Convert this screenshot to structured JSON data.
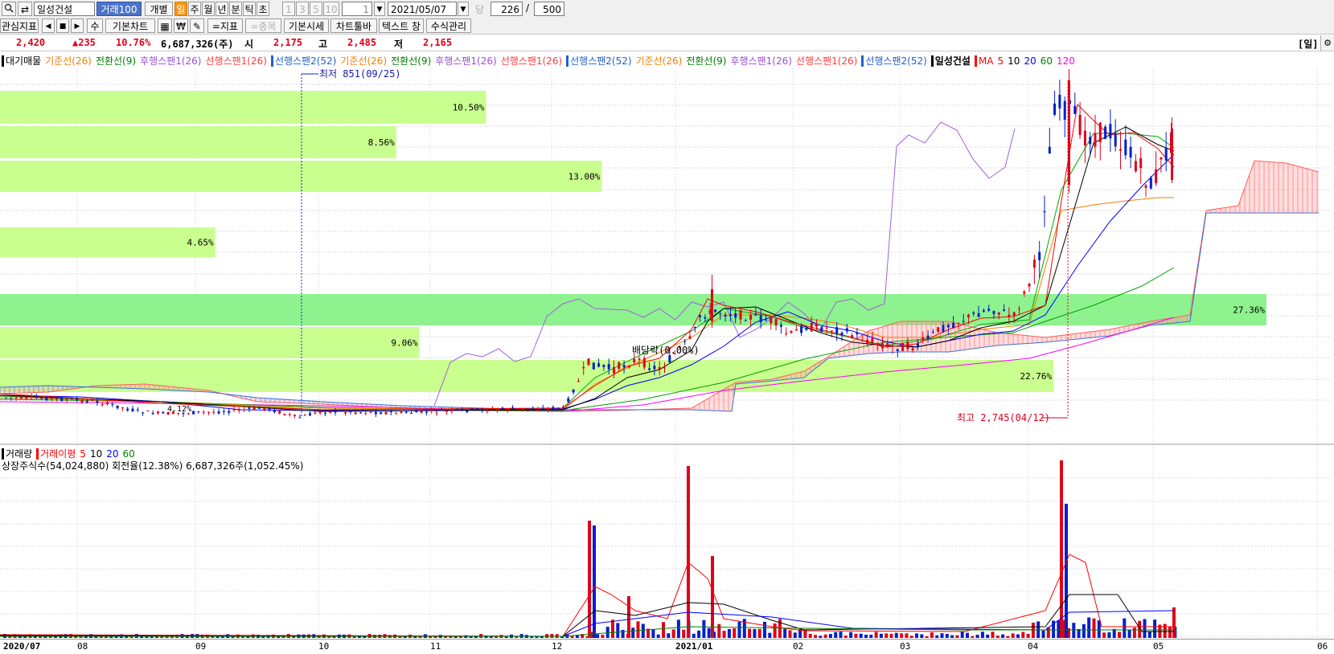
{
  "toolbar1": {
    "stock_name": "일성건설",
    "volume_btn": "거래100",
    "tabs": [
      "개별",
      "일",
      "주",
      "월",
      "년",
      "분",
      "틱",
      "초"
    ],
    "active_tab": "일",
    "num_btns": [
      "1",
      "3",
      "5",
      "10"
    ],
    "period_value": "1",
    "date_value": "2021/05/07",
    "dang_label": "당",
    "count_value": "226",
    "slash": "/",
    "total_value": "500"
  },
  "toolbar2": {
    "interest_btn": "관심지표",
    "su_btn": "수",
    "basic_chart": "기본차트",
    "jipyo_btn": "=지표",
    "jongmok_btn": "=종목",
    "basic_price": "기본시세",
    "chart_toolbar": "차트툴바",
    "text_window": "텍스트 창",
    "formula_mgmt": "수식관리",
    "won_icon": "₩"
  },
  "quote": {
    "price": "2,420",
    "change": "▲235",
    "change_pct": "10.76%",
    "volume": "6,687,326(주)",
    "open_label": "시",
    "open": "2,175",
    "high_label": "고",
    "high": "2,485",
    "low_label": "저",
    "low": "2,165",
    "period_btn": "[일]"
  },
  "legend": [
    {
      "text": "대기매물",
      "color": "#000000",
      "marker": true
    },
    {
      "text": "기준선(26)",
      "color": "#f08000"
    },
    {
      "text": "전환선(9)",
      "color": "#008000"
    },
    {
      "text": "후행스팬1(26)",
      "color": "#9a50d8"
    },
    {
      "text": "선행스팬1(26)",
      "color": "#ff3c3c"
    },
    {
      "text": "선행스팬2(52)",
      "color": "#2060d0",
      "marker": true
    },
    {
      "text": "기준선(26)",
      "color": "#f08000"
    },
    {
      "text": "전환선(9)",
      "color": "#008000"
    },
    {
      "text": "후행스팬1(26)",
      "color": "#9a50d8"
    },
    {
      "text": "선행스팬1(26)",
      "color": "#ff3c3c"
    },
    {
      "text": "선행스팬2(52)",
      "color": "#2060d0",
      "marker": true
    },
    {
      "text": "기준선(26)",
      "color": "#f08000"
    },
    {
      "text": "전환선(9)",
      "color": "#008000"
    },
    {
      "text": "후행스팬1(26)",
      "color": "#9a50d8"
    },
    {
      "text": "선행스팬1(26)",
      "color": "#ff3c3c"
    },
    {
      "text": "선행스팬2(52)",
      "color": "#2060d0",
      "marker": true
    },
    {
      "text": "일성건설",
      "color": "#000000",
      "marker": true,
      "bold": true
    },
    {
      "text": "MA",
      "color": "#ff0000",
      "marker": true
    },
    {
      "text": "5",
      "color": "#ff0000"
    },
    {
      "text": "10",
      "color": "#000000"
    },
    {
      "text": "20",
      "color": "#0000ff"
    },
    {
      "text": "60",
      "color": "#008000"
    },
    {
      "text": "120",
      "color": "#ff00ff"
    }
  ],
  "annotations": {
    "low": "최저 851(09/25)",
    "high": "최고 2,745(04/12)",
    "dividend": "배당락(0.00%)",
    "small_pct": "4.12%"
  },
  "volume_profile": [
    {
      "pct": "10.50%",
      "color": "#c9ff8e"
    },
    {
      "pct": "8.56%",
      "color": "#c9ff8e"
    },
    {
      "pct": "13.00%",
      "color": "#c9ff8e"
    },
    {
      "pct": "4.65%",
      "color": "#c9ff8e"
    },
    {
      "pct": "27.36%",
      "color": "#8ef28e"
    },
    {
      "pct": "9.06%",
      "color": "#c9ff8e"
    },
    {
      "pct": "22.76%",
      "color": "#c9ff8e"
    }
  ],
  "volume_panel": {
    "legend": [
      {
        "text": "거래량",
        "color": "#000000",
        "marker": true
      },
      {
        "text": "거래이평",
        "color": "#ff0000",
        "marker": true
      },
      {
        "text": "5",
        "color": "#ff0000"
      },
      {
        "text": "10",
        "color": "#000000"
      },
      {
        "text": "20",
        "color": "#0000ff"
      },
      {
        "text": "60",
        "color": "#008000"
      }
    ],
    "info": "상장주식수(54,024,880) 회전율(12.38%) 6,687,326주(1,052.45%)"
  },
  "x_axis": [
    "2020/07",
    "08",
    "09",
    "10",
    "11",
    "12",
    "2021/01",
    "02",
    "03",
    "04",
    "05",
    "06"
  ],
  "chart_data": {
    "type": "candlestick",
    "title": "일성건설",
    "period": "daily",
    "annotations": {
      "low": 851,
      "low_date": "09/25",
      "high": 2745,
      "high_date": "04/12"
    },
    "last": {
      "close": 2420,
      "change": 235,
      "change_pct": 10.76,
      "open": 2175,
      "high": 2485,
      "low": 2165,
      "volume": 6687326
    },
    "volume_profile_pct": [
      10.5,
      8.56,
      13.0,
      4.65,
      27.36,
      9.06,
      22.76
    ],
    "close_series": [
      {
        "date": "2020/07",
        "close": 930
      },
      {
        "date": "2020/08",
        "close": 890
      },
      {
        "date": "2020/09",
        "close": 870
      },
      {
        "date": "2020/10",
        "close": 880
      },
      {
        "date": "2020/11",
        "close": 880
      },
      {
        "date": "2020/12",
        "close": 1150
      },
      {
        "date": "2021/01",
        "close": 1520
      },
      {
        "date": "2021/02",
        "close": 1380
      },
      {
        "date": "2021/03",
        "close": 1280
      },
      {
        "date": "2021/04",
        "close": 2300
      },
      {
        "date": "2021/05",
        "close": 2420
      }
    ],
    "colors": {
      "up": "#e0001a",
      "down": "#0020c8",
      "ma5": "#ff0000",
      "ma10": "#000000",
      "ma20": "#0000ff",
      "ma60": "#008000",
      "ma120": "#ff00ff"
    }
  }
}
